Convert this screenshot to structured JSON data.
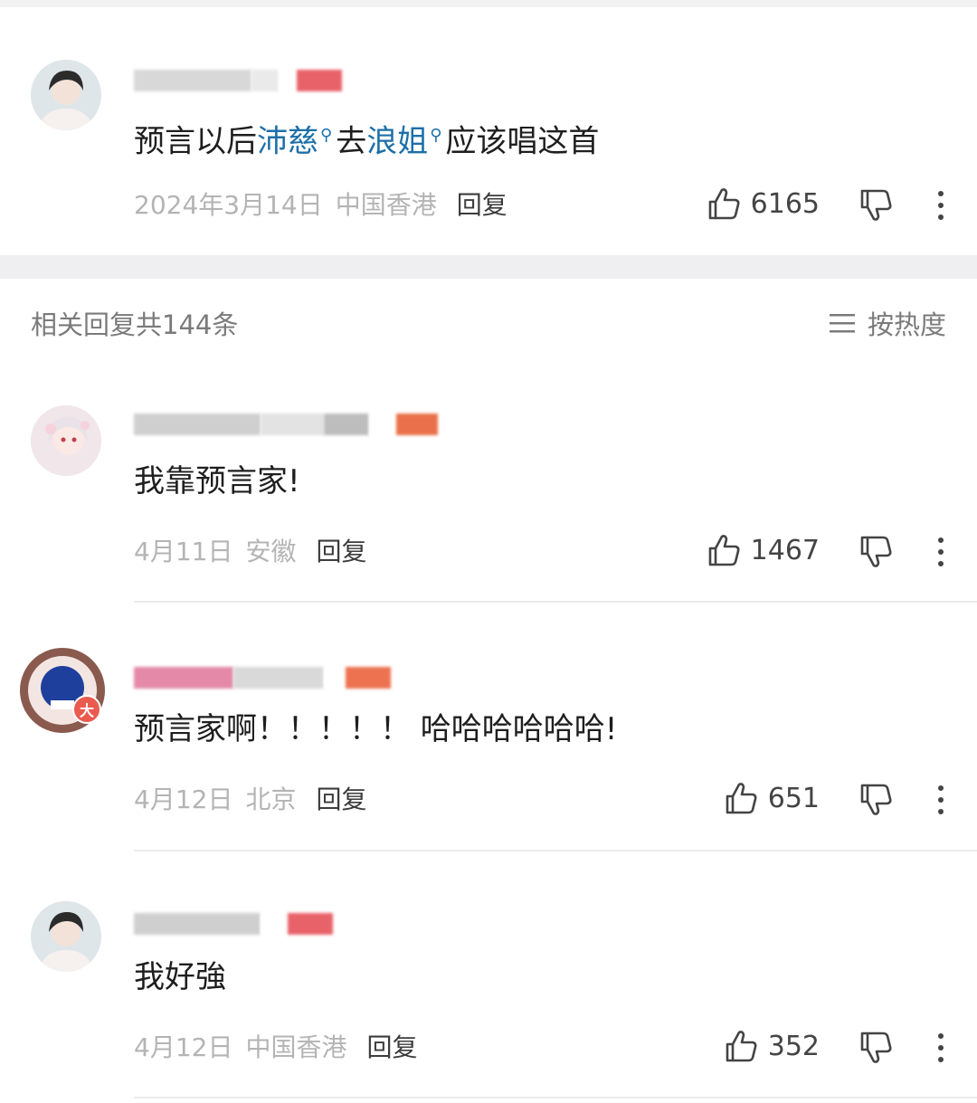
{
  "main_comment": {
    "text_parts": [
      {
        "t": "预言以后",
        "topic": false
      },
      {
        "t": "沛慈",
        "topic": true
      },
      {
        "t": "去",
        "topic": false
      },
      {
        "t": "浪姐",
        "topic": true
      },
      {
        "t": "应该唱这首",
        "topic": false
      }
    ],
    "date": "2024年3月14日",
    "location": "中国香港",
    "reply_label": "回复",
    "likes": "6165"
  },
  "replies_header": {
    "count_label": "相关回复共144条",
    "sort_label": "按热度"
  },
  "replies": [
    {
      "text": "我靠预言家!",
      "date": "4月11日",
      "location": "安徽",
      "reply_label": "回复",
      "likes": "1467"
    },
    {
      "text": "预言家啊！！！！！ 哈哈哈哈哈哈!",
      "date": "4月12日",
      "location": "北京",
      "reply_label": "回复",
      "likes": "651",
      "badge": "大"
    },
    {
      "text": "我好強",
      "date": "4月12日",
      "location": "中国香港",
      "reply_label": "回复",
      "likes": "352"
    }
  ],
  "icons": {
    "like": "thumbs-up-icon",
    "dislike": "thumbs-down-icon",
    "more": "more-vertical-icon",
    "sort": "menu-lines-icon",
    "topic_search": "search-icon"
  },
  "colors": {
    "topic_link": "#1c6fa8",
    "meta_gray": "#b4b4b4",
    "badge_red": "#ea5b4f"
  }
}
